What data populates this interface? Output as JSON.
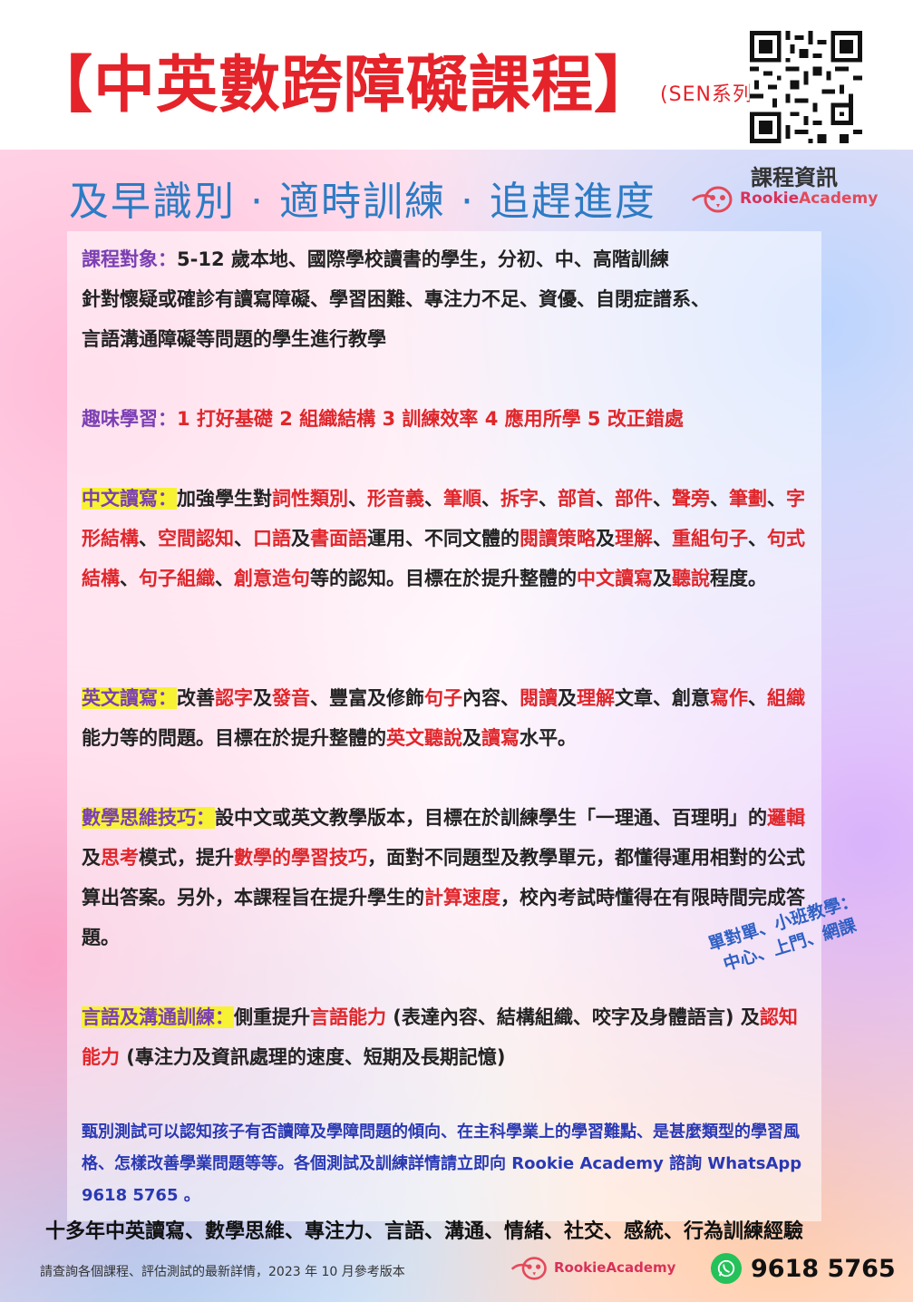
{
  "header": {
    "title": "【中英數跨障礙課程】",
    "series": "(SEN系列)"
  },
  "tagline": "及早識別 · 適時訓練 · 追趕進度",
  "info_label": "課程資訊",
  "brand": {
    "name_prefix": "Rookie",
    "name_suffix": "Academy"
  },
  "sections": {
    "target": {
      "label": "課程對象：",
      "line1": "5-12 歲本地、國際學校讀書的學生，分初、中、高階訓練",
      "line2": "針對懷疑或確診有讀寫障礙、學習困難、專注力不足、資優、自閉症譜系、",
      "line3": "言語溝通障礙等問題的學生進行教學"
    },
    "fun": {
      "label": "趣味學習：",
      "text": "1 打好基礎 2 組織結構 3 訓練效率 4 應用所學 5 改正錯處"
    },
    "chinese": {
      "label": "中文讀寫：",
      "parts": [
        [
          "加強學生對",
          "n"
        ],
        [
          "詞性類別",
          "r"
        ],
        [
          "、",
          "n"
        ],
        [
          "形音義",
          "r"
        ],
        [
          "、",
          "n"
        ],
        [
          "筆順",
          "r"
        ],
        [
          "、",
          "n"
        ],
        [
          "拆字",
          "r"
        ],
        [
          "、",
          "n"
        ],
        [
          "部首",
          "r"
        ],
        [
          "、",
          "n"
        ],
        [
          "部件",
          "r"
        ],
        [
          "、",
          "n"
        ],
        [
          "聲旁",
          "r"
        ],
        [
          "、",
          "n"
        ],
        [
          "筆劃",
          "r"
        ],
        [
          "、",
          "n"
        ],
        [
          "字形結構",
          "r"
        ],
        [
          "、",
          "n"
        ],
        [
          "空間認知",
          "r"
        ],
        [
          "、",
          "n"
        ],
        [
          "口語",
          "r"
        ],
        [
          "及",
          "n"
        ],
        [
          "書面語",
          "r"
        ],
        [
          "運用、不同文體的",
          "n"
        ],
        [
          "閱讀策略",
          "r"
        ],
        [
          "及",
          "n"
        ],
        [
          "理解",
          "r"
        ],
        [
          "、",
          "n"
        ],
        [
          "重組句子",
          "r"
        ],
        [
          "、",
          "n"
        ],
        [
          "句式結構",
          "r"
        ],
        [
          "、",
          "n"
        ],
        [
          "句子組織",
          "r"
        ],
        [
          "、",
          "n"
        ],
        [
          "創意造句",
          "r"
        ],
        [
          "等的認知。目標在於提升整體的",
          "n"
        ],
        [
          "中文讀寫",
          "r"
        ],
        [
          "及",
          "n"
        ],
        [
          "聽說",
          "r"
        ],
        [
          "程度。",
          "n"
        ]
      ]
    },
    "english": {
      "label": "英文讀寫：",
      "parts": [
        [
          "改善",
          "n"
        ],
        [
          "認字",
          "r"
        ],
        [
          "及",
          "n"
        ],
        [
          "發音",
          "r"
        ],
        [
          "、豐富及修飾",
          "n"
        ],
        [
          "句子",
          "r"
        ],
        [
          "內容、",
          "n"
        ],
        [
          "閱讀",
          "r"
        ],
        [
          "及",
          "n"
        ],
        [
          "理解",
          "r"
        ],
        [
          "文章、創意",
          "n"
        ],
        [
          "寫作",
          "r"
        ],
        [
          "、",
          "n"
        ],
        [
          "組織",
          "r"
        ],
        [
          "能力等的問題。目標在於提升整體的",
          "n"
        ],
        [
          "英文聽說",
          "r"
        ],
        [
          "及",
          "n"
        ],
        [
          "讀寫",
          "r"
        ],
        [
          "水平。",
          "n"
        ]
      ]
    },
    "math": {
      "label": "數學思維技巧：",
      "parts": [
        [
          "設中文或英文教學版本，目標在於訓練學生「一理通、百理明」的",
          "n"
        ],
        [
          "邏輯",
          "r"
        ],
        [
          "及",
          "n"
        ],
        [
          "思考",
          "r"
        ],
        [
          "模式，提升",
          "n"
        ],
        [
          "數學的學習技巧",
          "r"
        ],
        [
          "，面對不同題型及教學單元，都懂得運用相對的公式算出答案。另外，本課程旨在提升學生的",
          "n"
        ],
        [
          "計算速度",
          "r"
        ],
        [
          "，校內考試時懂得在有限時間完成答題。",
          "n"
        ]
      ]
    },
    "speech": {
      "label": "言語及溝通訓練：",
      "parts": [
        [
          "側重提升",
          "n"
        ],
        [
          "言語能力",
          "r"
        ],
        [
          " (表達內容、結構組織、咬字及身體語言) 及",
          "n"
        ],
        [
          "認知能力",
          "r"
        ],
        [
          " (專注力及資訊處理的速度、短期及長期記憶)",
          "n"
        ]
      ]
    }
  },
  "badge": {
    "line1": "單對單、小班教學：",
    "line2": "中心、上門、網課"
  },
  "assessment_note": "甄別測試可以認知孩子有否讀障及學障問題的傾向、在主科學業上的學習難點、是甚麼類型的學習風格、怎樣改善學業問題等等。各個測試及訓練詳情請立即向 Rookie Academy 諮詢 WhatsApp 9618 5765 。",
  "experience": "十多年中英讀寫、數學思維、專注力、言語、溝通、情緒、社交、感統、行為訓練經驗",
  "footer_note": "請查詢各個課程、評估測試的最新詳情，2023 年 10 月參考版本",
  "whatsapp": "9618 5765",
  "colors": {
    "title_red": "#e5232a",
    "tagline_blue": "#2d7bc4",
    "label_purple": "#7b3fb3",
    "highlight_yellow": "#f7f233",
    "note_blue": "#2a39b4",
    "whatsapp_green": "#25c15a"
  }
}
